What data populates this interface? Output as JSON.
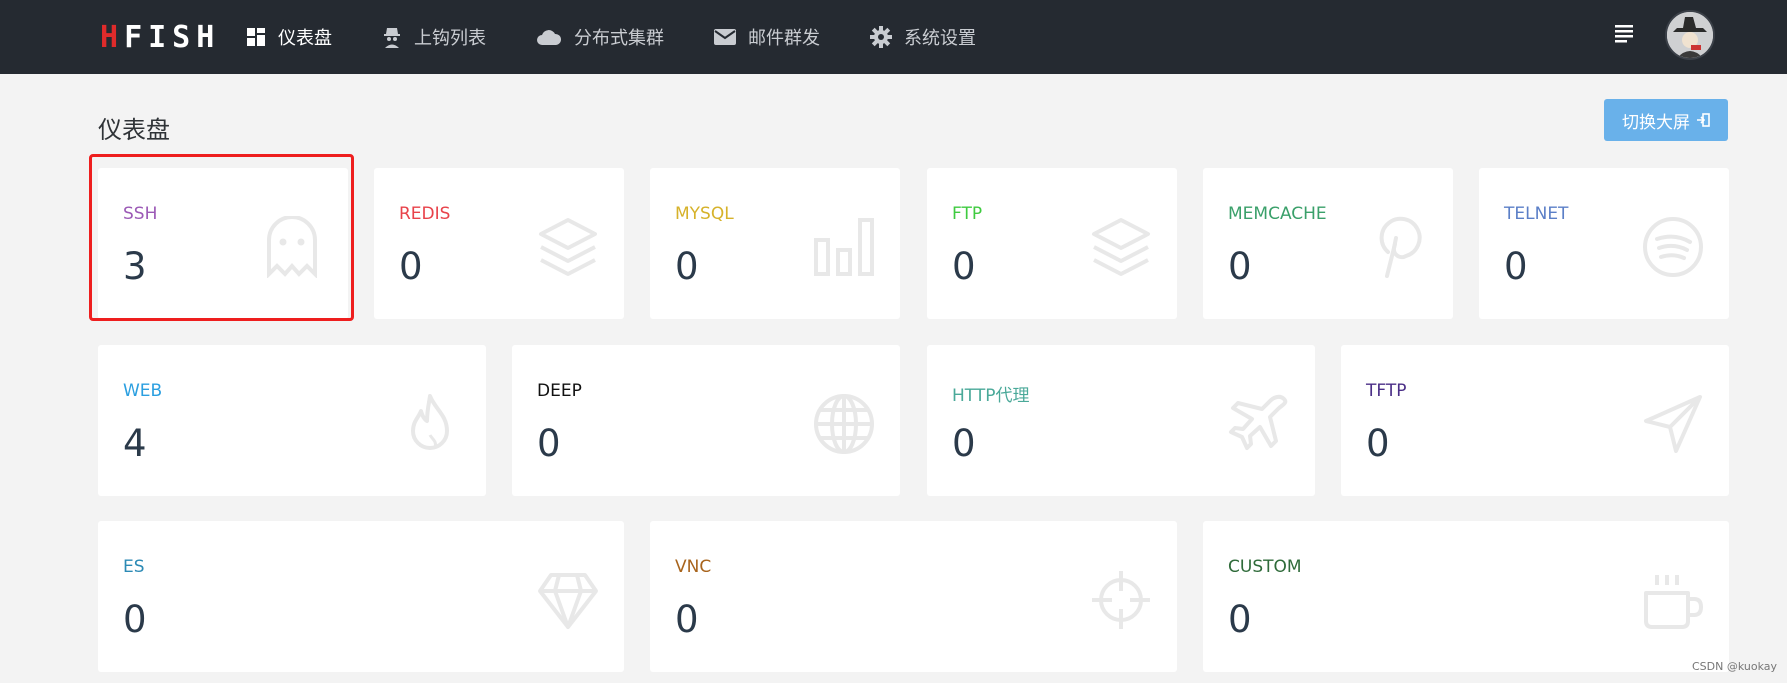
{
  "logo": {
    "part1": "H",
    "part2": "FISH"
  },
  "nav": [
    {
      "label": "仪表盘",
      "icon": "dashboard-icon"
    },
    {
      "label": "上钩列表",
      "icon": "spy-icon"
    },
    {
      "label": "分布式集群",
      "icon": "cloud-icon"
    },
    {
      "label": "邮件群发",
      "icon": "envelope-icon"
    },
    {
      "label": "系统设置",
      "icon": "gear-icon"
    }
  ],
  "page_title": "仪表盘",
  "fullscreen_button": "切换大屏",
  "cards": [
    {
      "label": "SSH",
      "value": "3",
      "color": "#9b59b6",
      "icon": "ghost-icon"
    },
    {
      "label": "REDIS",
      "value": "0",
      "color": "#e8424a",
      "icon": "layers-icon"
    },
    {
      "label": "MYSQL",
      "value": "0",
      "color": "#d6b22a",
      "icon": "bar-chart-icon"
    },
    {
      "label": "FTP",
      "value": "0",
      "color": "#3fcb40",
      "icon": "layers-icon"
    },
    {
      "label": "MEMCACHE",
      "value": "0",
      "color": "#3aa06a",
      "icon": "pinterest-icon"
    },
    {
      "label": "TELNET",
      "value": "0",
      "color": "#5b7fc7",
      "icon": "spotify-icon"
    },
    {
      "label": "WEB",
      "value": "4",
      "color": "#2b9fe0",
      "icon": "fire-icon"
    },
    {
      "label": "DEEP",
      "value": "0",
      "color": "#111111",
      "icon": "globe-icon"
    },
    {
      "label": "HTTP代理",
      "value": "0",
      "color": "#4aa999",
      "icon": "plane-icon"
    },
    {
      "label": "TFTP",
      "value": "0",
      "color": "#4b2f87",
      "icon": "paper-plane-icon"
    },
    {
      "label": "ES",
      "value": "0",
      "color": "#2c8ab5",
      "icon": "diamond-icon"
    },
    {
      "label": "VNC",
      "value": "0",
      "color": "#a8641d",
      "icon": "crosshairs-icon"
    },
    {
      "label": "CUSTOM",
      "value": "0",
      "color": "#2f6b3a",
      "icon": "coffee-icon"
    }
  ],
  "watermark": "CSDN @kuokay"
}
